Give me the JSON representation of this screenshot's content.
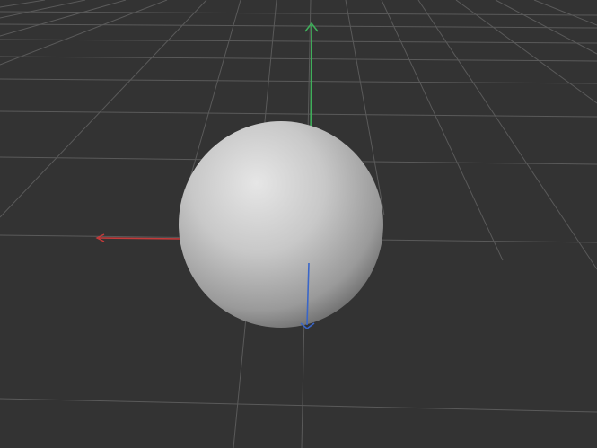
{
  "viewport": {
    "background_color": "#333333",
    "grid": "on",
    "grid_color": "#5a5a5a"
  },
  "object": {
    "shape": "sphere",
    "shading": "smooth",
    "base_color": "#c8c8c8",
    "highlight_color": "#e6e6e6",
    "shadow_color": "#6a6a6a"
  },
  "axes": {
    "x_color": "#c43b3b",
    "y_color": "#3fae5a",
    "z_color": "#3a66c8"
  }
}
